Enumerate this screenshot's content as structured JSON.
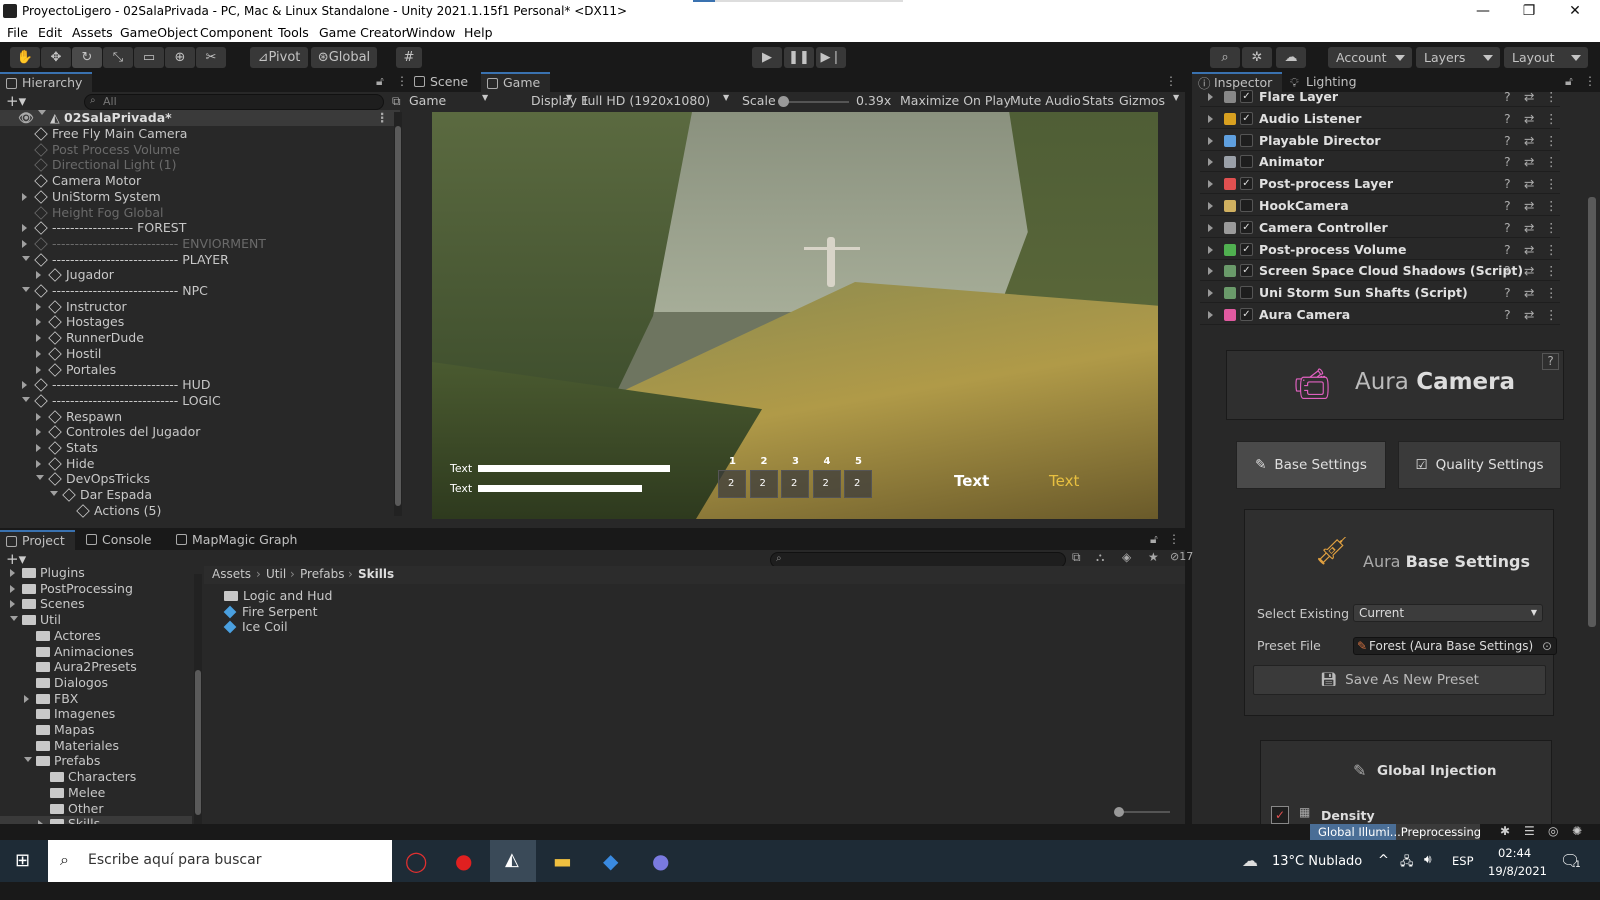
{
  "window": {
    "title": "ProyectoLigero - 02SalaPrivada - PC, Mac & Linux Standalone - Unity 2021.1.15f1 Personal* <DX11>",
    "minimize": "—",
    "maximize": "❐",
    "close": "✕"
  },
  "menu": [
    "File",
    "Edit",
    "Assets",
    "GameObject",
    "Component",
    "Tools",
    "Game Creator",
    "Window",
    "Help"
  ],
  "toolbar": {
    "pivot": "Pivot",
    "global": "Global",
    "account": "Account",
    "layers": "Layers",
    "layout": "Layout"
  },
  "hierarchy": {
    "tab": "Hierarchy",
    "search_placeholder": "All",
    "scene": "02SalaPrivada*",
    "items": [
      {
        "label": "Free Fly Main Camera",
        "dim": false
      },
      {
        "label": "Post Process Volume",
        "dim": true
      },
      {
        "label": "Directional Light (1)",
        "dim": true
      },
      {
        "label": "Camera Motor",
        "dim": false
      },
      {
        "label": "UniStorm System",
        "dim": false
      },
      {
        "label": "Height Fog Global",
        "dim": true
      },
      {
        "label": "------------------ FOREST",
        "dim": false
      },
      {
        "label": "---------------------------- ENVIORMENT",
        "dim": true
      },
      {
        "label": "---------------------------- PLAYER",
        "dim": false
      },
      {
        "label": "Jugador",
        "dim": false
      },
      {
        "label": "---------------------------- NPC",
        "dim": false
      },
      {
        "label": "Instructor",
        "dim": false
      },
      {
        "label": "Hostages",
        "dim": false
      },
      {
        "label": "RunnerDude",
        "dim": false
      },
      {
        "label": "Hostil",
        "dim": false
      },
      {
        "label": "Portales",
        "dim": false
      },
      {
        "label": "---------------------------- HUD",
        "dim": false
      },
      {
        "label": "---------------------------- LOGIC",
        "dim": false
      },
      {
        "label": "Respawn",
        "dim": false
      },
      {
        "label": "Controles del Jugador",
        "dim": false
      },
      {
        "label": "Stats",
        "dim": false
      },
      {
        "label": "Hide",
        "dim": false
      },
      {
        "label": "DevOpsTricks",
        "dim": false
      },
      {
        "label": "Dar Espada",
        "dim": false
      },
      {
        "label": "Actions (5)",
        "dim": false
      }
    ]
  },
  "game": {
    "tabs": [
      "Scene",
      "Game"
    ],
    "view_mode": "Game",
    "display": "Display 1",
    "resolution": "Full HD (1920x1080)",
    "scale_label": "Scale",
    "scale_value": "0.39x",
    "maximize": "Maximize On Play",
    "mute": "Mute Audio",
    "stats": "Stats",
    "gizmos": "Gizmos",
    "hud_text1": "Text",
    "hud_text2": "Text",
    "hud_text_big": "Text",
    "hud_text_yellow": "Text",
    "slots_top": [
      "1",
      "2",
      "3",
      "4",
      "5"
    ],
    "slots_bottom": [
      "2",
      "2",
      "2",
      "2",
      "2"
    ]
  },
  "inspector": {
    "tab": "Inspector",
    "tab2": "Lighting",
    "components": [
      {
        "name": "Flare Layer",
        "checked": true,
        "color": "#888888"
      },
      {
        "name": "Audio Listener",
        "checked": true,
        "color": "#d8a020"
      },
      {
        "name": "Playable Director",
        "checked": false,
        "color": "#5fa0e0"
      },
      {
        "name": "Animator",
        "checked": false,
        "color": "#9aa0a8"
      },
      {
        "name": "Post-process Layer",
        "checked": true,
        "color": "#e05050"
      },
      {
        "name": "HookCamera",
        "checked": false,
        "color": "#d0b060"
      },
      {
        "name": "Camera Controller",
        "checked": true,
        "color": "#9a9a9a"
      },
      {
        "name": "Post-process Volume",
        "checked": true,
        "color": "#50b050"
      },
      {
        "name": "Screen Space Cloud Shadows (Script)",
        "checked": true,
        "color": "#6a9a6a"
      },
      {
        "name": "Uni Storm Sun Shafts (Script)",
        "checked": false,
        "color": "#6a9a6a"
      },
      {
        "name": "Aura Camera",
        "checked": true,
        "color": "#e05aa0"
      }
    ],
    "aura": {
      "title_light": "Aura ",
      "title_bold": "Camera",
      "base_btn": "Base Settings",
      "quality_btn": "Quality Settings",
      "base_title_light": "Aura ",
      "base_title_bold": "Base Settings",
      "select_existing_label": "Select Existing",
      "select_existing_value": "Current",
      "preset_file_label": "Preset File",
      "preset_file_value": "Forest (Aura Base Settings)",
      "save_preset": "Save As New Preset",
      "global_injection": "Global Injection",
      "density": "Density"
    }
  },
  "project": {
    "tabs": [
      "Project",
      "Console",
      "MapMagic Graph"
    ],
    "count": "17",
    "tree": [
      {
        "label": "Plugins",
        "indent": 1,
        "arrow": "closed"
      },
      {
        "label": "PostProcessing",
        "indent": 1,
        "arrow": "closed"
      },
      {
        "label": "Scenes",
        "indent": 1,
        "arrow": "closed"
      },
      {
        "label": "Util",
        "indent": 1,
        "arrow": "open"
      },
      {
        "label": "Actores",
        "indent": 2,
        "arrow": "none"
      },
      {
        "label": "Animaciones",
        "indent": 2,
        "arrow": "none"
      },
      {
        "label": "Aura2Presets",
        "indent": 2,
        "arrow": "none"
      },
      {
        "label": "Dialogos",
        "indent": 2,
        "arrow": "none"
      },
      {
        "label": "FBX",
        "indent": 2,
        "arrow": "closed"
      },
      {
        "label": "Imagenes",
        "indent": 2,
        "arrow": "none"
      },
      {
        "label": "Mapas",
        "indent": 2,
        "arrow": "none"
      },
      {
        "label": "Materiales",
        "indent": 2,
        "arrow": "none"
      },
      {
        "label": "Prefabs",
        "indent": 2,
        "arrow": "open"
      },
      {
        "label": "Characters",
        "indent": 3,
        "arrow": "none"
      },
      {
        "label": "Melee",
        "indent": 3,
        "arrow": "none"
      },
      {
        "label": "Other",
        "indent": 3,
        "arrow": "none"
      },
      {
        "label": "Skills",
        "indent": 3,
        "arrow": "closed"
      }
    ],
    "breadcrumb": [
      "Assets",
      "Util",
      "Prefabs",
      "Skills"
    ],
    "files": [
      {
        "label": "Logic and Hud",
        "type": "folder"
      },
      {
        "label": "Fire Serpent",
        "type": "prefab"
      },
      {
        "label": "Ice Coil",
        "type": "prefab"
      }
    ]
  },
  "status": {
    "progress_text": "Global Illumi...Preprocessing"
  },
  "taskbar": {
    "search_placeholder": "Escribe aquí para buscar",
    "weather": "13°C  Nublado",
    "lang": "ESP",
    "time": "02:44",
    "date": "19/8/2021",
    "notif": "1"
  }
}
